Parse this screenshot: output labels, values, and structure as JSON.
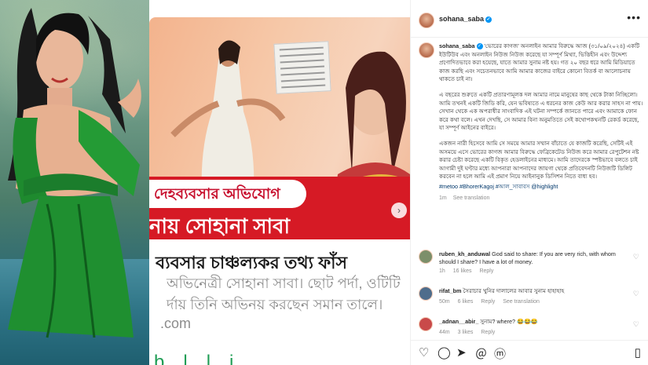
{
  "article": {
    "banner_line1": "দেহব্যবসার অভিযোগ",
    "banner_line2": "নায় সোহানা সাবা",
    "headline": "ব্যবসার চাঞ্চল্যকর তথ্য ফাঁস",
    "sub_line1": "অভিনেত্রী সোহানা সাবা। ছোট পর্দা, ওটিটি",
    "sub_line2": "র্দায় তিনি অভিনয় করছেন সমান তালে।",
    "url_fragment": ".com",
    "bottom_fragment": "b...l...l...i...."
  },
  "post": {
    "username": "sohana_saba",
    "more_icon": "ellipsis-icon",
    "caption_username": "sohana_saba",
    "caption_p1": "'ভোরের কাগজ' অনলাইন আমার বিরুদ্ধে আজ (৩১/০৯/২০২৪) একটি ইউটিউব এবং অনলাইন নিউজ নিউজ করেছে যা সম্পূর্ণ মিথ্যা, ভিত্তিহীন এবং উদ্দেশ্য প্রণোদিতভাবে করা হয়েছে, যাতে আমার সুনাম নষ্ট হয়। গত ২০ বছর ধরে আমি মিডিয়াতে কাজ করছি এবং সচেতনভাবে আমি আমার কাজের বাইরে কোনো বিতর্ক বা আলোচনায় থাকতে চাই না।",
    "caption_p2": "এ বছরের শুরুতে একটি প্রতারণামূলক দল আমার নামে মানুষের কাছ থেকে টাকা নিচ্ছিলো। আমি তখনই একটি জিডি করি, যেন ভবিষ্যতে এ ধরনের কাজ কেউ আর করার সাহস না পায়। সেখান থেকে এক অপরাধীর সাংবাদিক এই ঘটনা সম্পর্কে জানতে পারে এবং আমাকে ফোন করে কথা বলে। এখন দেখছি, সে আমার বিনা অনুমতিতে সেই কথোপকথনটি রেকর্ড করেছে, যা সম্পূর্ণ আইনের বাইরে।",
    "caption_p3": "একজন নারী হিসেবে আমি সে সময়ে আমার সম্মান বাঁচাতে যে কাজটি করেছি, সেটিই এই অসময়ে এসে ভোরের কাগজ আমার বিরুদ্ধে ফেব্রিকেটেড নিউজ করে আমার রেপুটেশন নষ্ট করার চেষ্টা করেছে একটি বিকৃত হেডলাইনের মাধ্যমে। আমি তাদেরকে স্পষ্টভাবে বলতে চাই আগামী দুই ঘণ্টার মধ্যে আপনারা আপনাদের জায়গা থেকে প্রতিবেদনটি নিউজটি ডিলিট করবেন না হলে আমি এই প্রমাণ নিয়ে আইনানুক ডিসিশন নিতে বাধ্য হব।",
    "hashtags": "#metoo #BhorerKagoj #আল_সাবাবস @highlight",
    "caption_time": "1m",
    "see_translation": "See translation"
  },
  "comments": [
    {
      "username": "ruben_kh_anduwal",
      "text": "God said to share: If you are very rich, with whom should I share? I have a lot of money.",
      "time": "1h",
      "likes": "16 likes",
      "reply": "Reply",
      "extra": ""
    },
    {
      "username": "rifat_bm",
      "text": "সৈরাচার খুনির দালালের আবার সুনাম হাহাহাহ",
      "time": "50m",
      "likes": "6 likes",
      "reply": "Reply",
      "extra": "See translation"
    },
    {
      "username": "_adnan__abir_",
      "text": "সুনাম? where? 😂😂😂",
      "time": "44m",
      "likes": "3 likes",
      "reply": "Reply",
      "extra": ""
    }
  ],
  "actions": {
    "like_icon": "heart-icon",
    "comment_icon": "comment-icon",
    "share_icon": "share-icon",
    "save_icon": "bookmark-icon"
  }
}
